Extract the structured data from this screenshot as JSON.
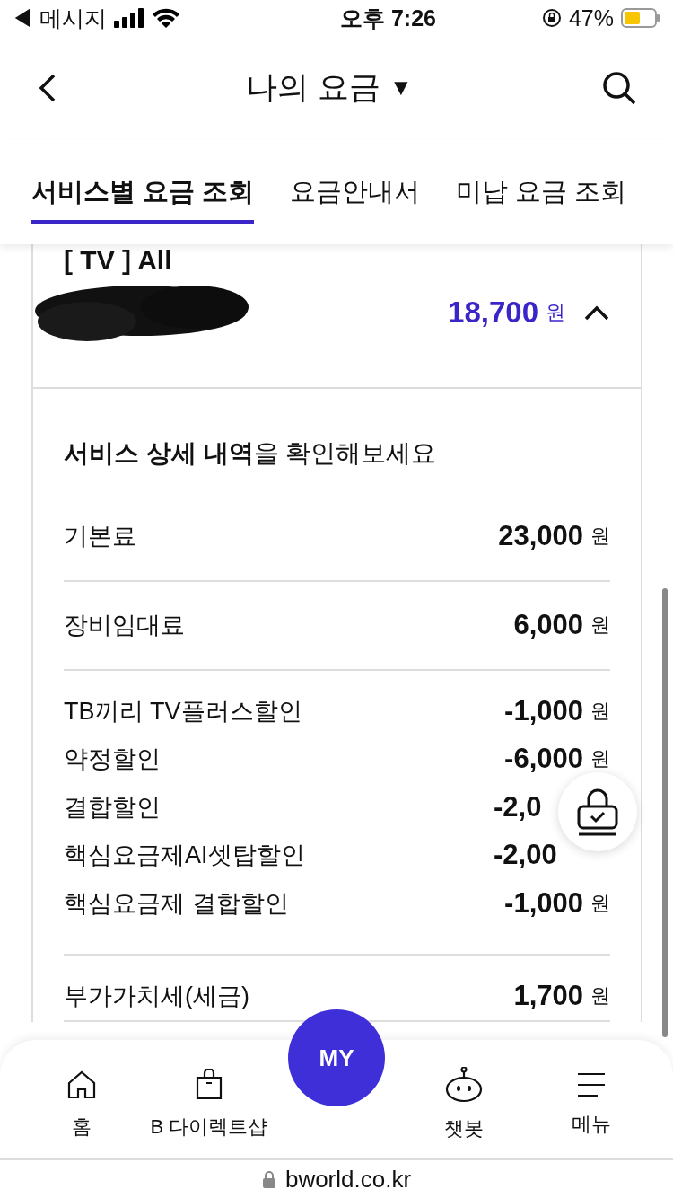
{
  "status_bar": {
    "back_app": "◀ 메시지",
    "time": "오후 7:26",
    "battery": "47%"
  },
  "header": {
    "title": "나의 요금",
    "dropdown": "▼"
  },
  "tabs": [
    {
      "label": "서비스별 요금 조회",
      "selected": true
    },
    {
      "label": "요금안내서",
      "selected": false
    },
    {
      "label": "미납 요금 조회",
      "selected": false
    }
  ],
  "service": {
    "name": "[ TV ] All",
    "amount": "18,700",
    "unit": "원",
    "expanded": true
  },
  "details": {
    "heading": "**서비스 상세 내역**을 확인해보세요",
    "groups": [
      [
        {
          "label": "기본료",
          "amount": "23,000",
          "unit": "원"
        }
      ],
      [
        {
          "label": "장비임대료",
          "amount": "6,000",
          "unit": "원"
        }
      ],
      [
        {
          "label": "TB끼리 TV플러스할인",
          "amount": "-1,000",
          "unit": "원"
        },
        {
          "label": "약정할인",
          "amount": "-6,000",
          "unit": "원"
        },
        {
          "label": "결합할인",
          "amount": "-2,0"
        },
        {
          "label": "핵심요금제AI셋탑할인",
          "amount": "-2,00"
        },
        {
          "label": "핵심요금제 결합할인",
          "amount": "-1,000",
          "unit": "원"
        }
      ],
      [
        {
          "label": "부가가치세(세금)",
          "amount": "1,700",
          "unit": "원"
        }
      ]
    ]
  },
  "nav": [
    {
      "label": "홈",
      "kind": "home"
    },
    {
      "label": "B 다이렉트샵",
      "kind": "shop"
    },
    {
      "label": "MY",
      "kind": "my"
    },
    {
      "label": "챗봇",
      "kind": "chatbot"
    },
    {
      "label": "메뉴",
      "kind": "menu"
    }
  ],
  "url": "bworld.co.kr"
}
